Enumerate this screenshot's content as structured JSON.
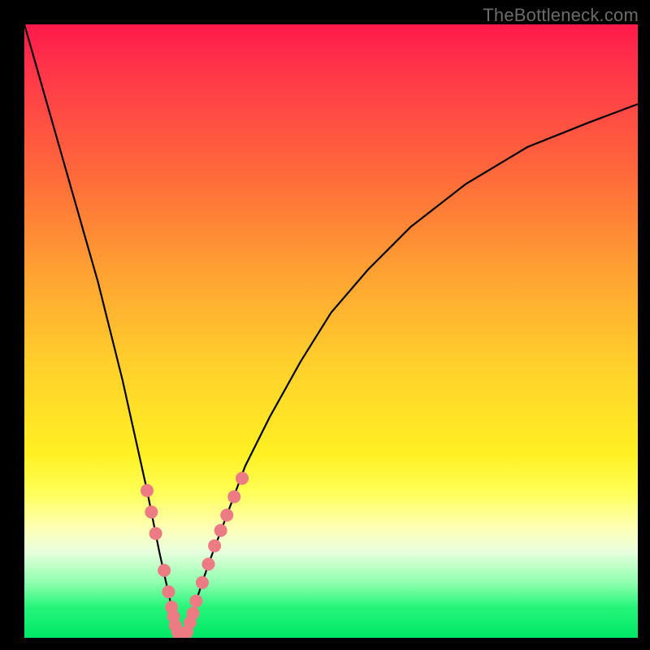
{
  "watermark": "TheBottleneck.com",
  "chart_data": {
    "type": "line",
    "title": "",
    "xlabel": "",
    "ylabel": "",
    "xlim": [
      0,
      100
    ],
    "ylim": [
      0,
      100
    ],
    "grid": false,
    "series": [
      {
        "name": "bottleneck-curve",
        "x": [
          0,
          2,
          4,
          6,
          8,
          10,
          12,
          14,
          16,
          18,
          20,
          22,
          24,
          24.8,
          25.6,
          26.4,
          27.2,
          28,
          30,
          33,
          36,
          40,
          45,
          50,
          56,
          63,
          72,
          82,
          92,
          100
        ],
        "y": [
          100,
          93,
          86,
          79,
          72,
          65,
          58,
          50,
          42,
          33,
          24,
          14,
          5,
          1.5,
          0,
          1,
          3,
          6,
          12,
          20,
          28,
          36,
          45,
          53,
          60,
          67,
          74,
          80,
          84,
          87
        ]
      }
    ],
    "markers": {
      "name": "sample-points",
      "color": "#ed7b84",
      "points": [
        {
          "x": 20.0,
          "y": 24.0
        },
        {
          "x": 20.7,
          "y": 20.5
        },
        {
          "x": 21.4,
          "y": 17.0
        },
        {
          "x": 22.8,
          "y": 11.0
        },
        {
          "x": 23.5,
          "y": 7.5
        },
        {
          "x": 24.0,
          "y": 5.0
        },
        {
          "x": 24.3,
          "y": 3.5
        },
        {
          "x": 24.6,
          "y": 2.0
        },
        {
          "x": 25.0,
          "y": 1.0
        },
        {
          "x": 25.3,
          "y": 0.3
        },
        {
          "x": 25.6,
          "y": 0.0
        },
        {
          "x": 26.0,
          "y": 0.2
        },
        {
          "x": 26.5,
          "y": 1.0
        },
        {
          "x": 27.0,
          "y": 2.5
        },
        {
          "x": 27.5,
          "y": 4.0
        },
        {
          "x": 28.0,
          "y": 6.0
        },
        {
          "x": 29.0,
          "y": 9.0
        },
        {
          "x": 30.0,
          "y": 12.0
        },
        {
          "x": 31.0,
          "y": 15.0
        },
        {
          "x": 32.0,
          "y": 17.5
        },
        {
          "x": 33.0,
          "y": 20.0
        },
        {
          "x": 34.2,
          "y": 23.0
        },
        {
          "x": 35.5,
          "y": 26.0
        }
      ]
    }
  }
}
